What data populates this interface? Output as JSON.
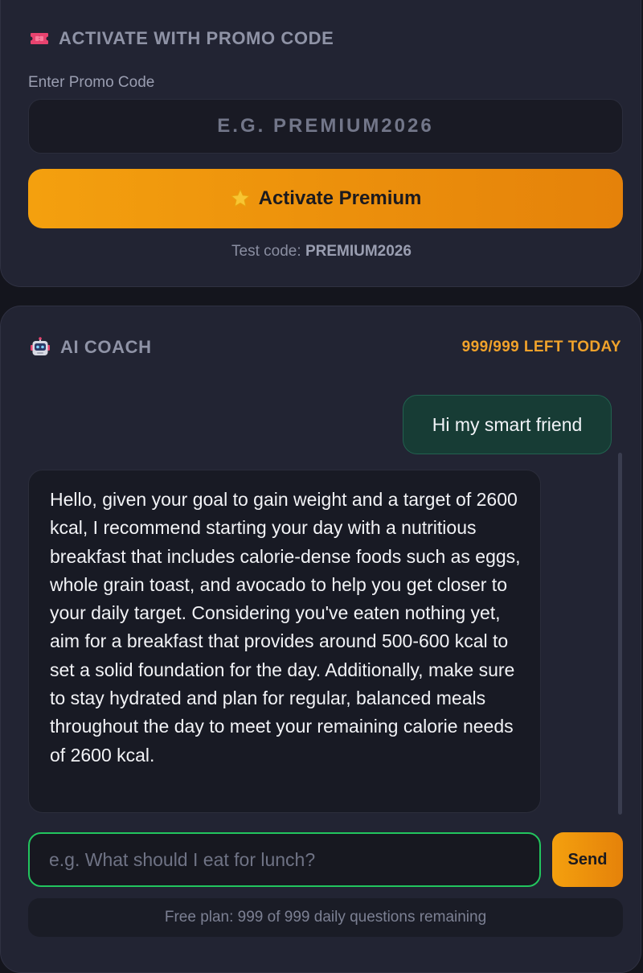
{
  "promo": {
    "title": "Activate with Promo Code",
    "icon": "ticket-icon",
    "input_label": "Enter Promo Code",
    "input_placeholder": "e.g. PREMIUM2026",
    "input_value": "",
    "button_label": "Activate Premium",
    "button_icon": "star-icon",
    "test_code_label": "Test code:",
    "test_code_value": "PREMIUM2026"
  },
  "coach": {
    "title": "AI Coach",
    "icon": "robot-icon",
    "quota_text": "999/999 left today",
    "messages": [
      {
        "role": "user",
        "text": "Hi my smart friend"
      },
      {
        "role": "assistant",
        "text": "Hello, given your goal to gain weight and a target of 2600 kcal, I recommend starting your day with a nutritious breakfast that includes calorie-dense foods such as eggs, whole grain toast, and avocado to help you get closer to your daily target. Considering you've eaten nothing yet, aim for a breakfast that provides around 500-600 kcal to set a solid foundation for the day. Additionally, make sure to stay hydrated and plan for regular, balanced meals throughout the day to meet your remaining calorie needs of 2600 kcal."
      }
    ],
    "input_placeholder": "e.g. What should I eat for lunch?",
    "input_value": "",
    "send_label": "Send",
    "plan_status": "Free plan: 999 of 999 daily questions remaining"
  },
  "colors": {
    "page_bg": "#14151d",
    "card_bg": "#222433",
    "accent_orange": "#f4a00e",
    "quota_orange": "#f0a22b",
    "focus_green": "#22c55e",
    "user_bubble": "#173c35"
  }
}
